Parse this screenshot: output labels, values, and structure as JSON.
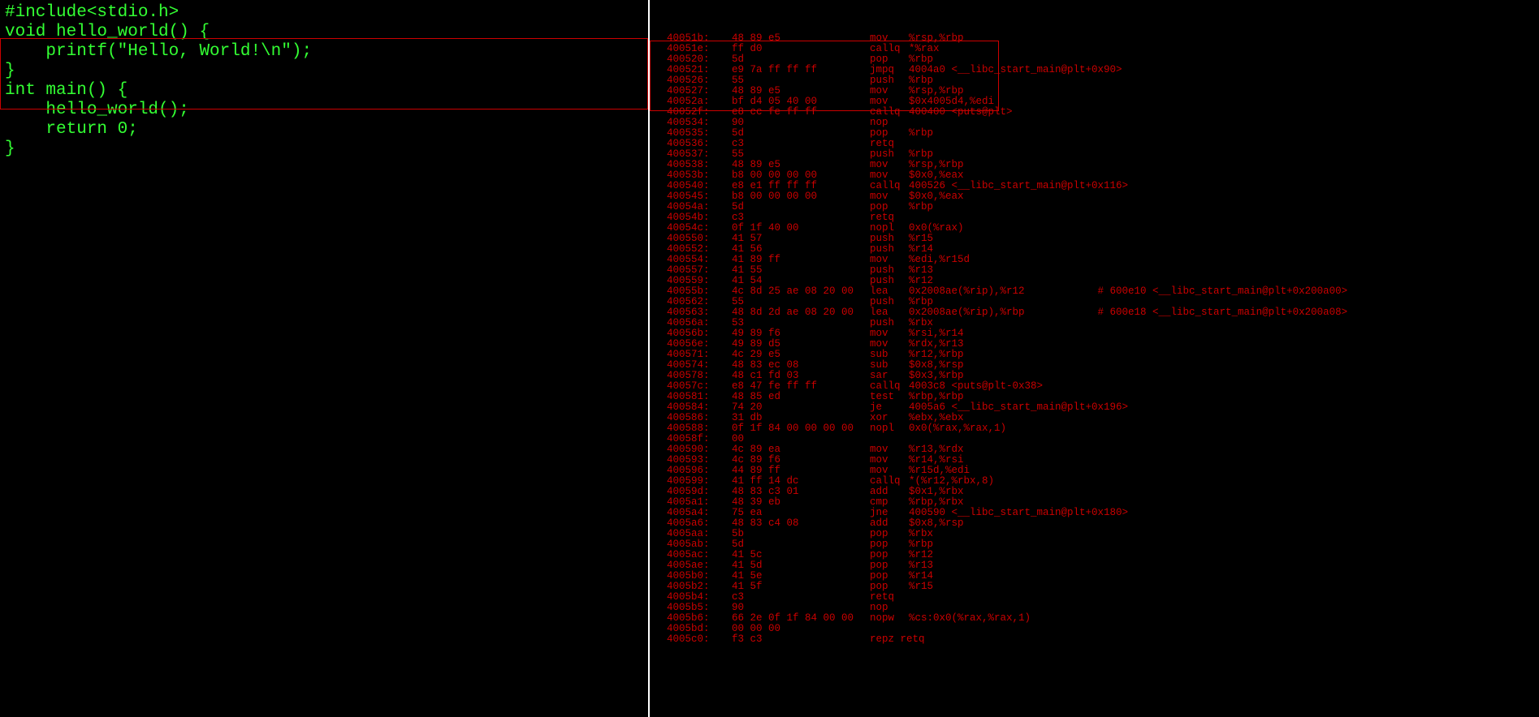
{
  "source": {
    "lines": [
      "#include<stdio.h>",
      "",
      "void hello_world() {",
      "    printf(\"Hello, World!\\n\");",
      "}",
      "",
      "",
      "int main() {",
      "    hello_world();",
      "    return 0;",
      "}"
    ]
  },
  "asm": {
    "rows": [
      {
        "addr": "40051b:",
        "bytes": "48 89 e5",
        "mnem": "mov",
        "ops": "%rsp,%rbp"
      },
      {
        "addr": "40051e:",
        "bytes": "ff d0",
        "mnem": "callq",
        "ops": "*%rax"
      },
      {
        "addr": "400520:",
        "bytes": "5d",
        "mnem": "pop",
        "ops": "%rbp"
      },
      {
        "addr": "400521:",
        "bytes": "e9 7a ff ff ff",
        "mnem": "jmpq",
        "ops": "4004a0 <__libc_start_main@plt+0x90>"
      },
      {
        "addr": "400526:",
        "bytes": "55",
        "mnem": "push",
        "ops": "%rbp"
      },
      {
        "addr": "400527:",
        "bytes": "48 89 e5",
        "mnem": "mov",
        "ops": "%rsp,%rbp"
      },
      {
        "addr": "40052a:",
        "bytes": "bf d4 05 40 00",
        "mnem": "mov",
        "ops": "$0x4005d4,%edi"
      },
      {
        "addr": "40052f:",
        "bytes": "e8 cc fe ff ff",
        "mnem": "callq",
        "ops": "400400 <puts@plt>"
      },
      {
        "addr": "400534:",
        "bytes": "90",
        "mnem": "nop",
        "ops": ""
      },
      {
        "addr": "400535:",
        "bytes": "5d",
        "mnem": "pop",
        "ops": "%rbp"
      },
      {
        "addr": "400536:",
        "bytes": "c3",
        "mnem": "retq",
        "ops": ""
      },
      {
        "addr": "400537:",
        "bytes": "55",
        "mnem": "push",
        "ops": "%rbp"
      },
      {
        "addr": "400538:",
        "bytes": "48 89 e5",
        "mnem": "mov",
        "ops": "%rsp,%rbp"
      },
      {
        "addr": "40053b:",
        "bytes": "b8 00 00 00 00",
        "mnem": "mov",
        "ops": "$0x0,%eax"
      },
      {
        "addr": "400540:",
        "bytes": "e8 e1 ff ff ff",
        "mnem": "callq",
        "ops": "400526 <__libc_start_main@plt+0x116>"
      },
      {
        "addr": "400545:",
        "bytes": "b8 00 00 00 00",
        "mnem": "mov",
        "ops": "$0x0,%eax"
      },
      {
        "addr": "40054a:",
        "bytes": "5d",
        "mnem": "pop",
        "ops": "%rbp"
      },
      {
        "addr": "40054b:",
        "bytes": "c3",
        "mnem": "retq",
        "ops": ""
      },
      {
        "addr": "40054c:",
        "bytes": "0f 1f 40 00",
        "mnem": "nopl",
        "ops": "0x0(%rax)"
      },
      {
        "addr": "400550:",
        "bytes": "41 57",
        "mnem": "push",
        "ops": "%r15"
      },
      {
        "addr": "400552:",
        "bytes": "41 56",
        "mnem": "push",
        "ops": "%r14"
      },
      {
        "addr": "400554:",
        "bytes": "41 89 ff",
        "mnem": "mov",
        "ops": "%edi,%r15d"
      },
      {
        "addr": "400557:",
        "bytes": "41 55",
        "mnem": "push",
        "ops": "%r13"
      },
      {
        "addr": "400559:",
        "bytes": "41 54",
        "mnem": "push",
        "ops": "%r12"
      },
      {
        "addr": "40055b:",
        "bytes": "4c 8d 25 ae 08 20 00",
        "mnem": "lea",
        "ops": "0x2008ae(%rip),%r12",
        "comment": "# 600e10 <__libc_start_main@plt+0x200a00>"
      },
      {
        "addr": "400562:",
        "bytes": "55",
        "mnem": "push",
        "ops": "%rbp"
      },
      {
        "addr": "400563:",
        "bytes": "48 8d 2d ae 08 20 00",
        "mnem": "lea",
        "ops": "0x2008ae(%rip),%rbp",
        "comment": "# 600e18 <__libc_start_main@plt+0x200a08>"
      },
      {
        "addr": "40056a:",
        "bytes": "53",
        "mnem": "push",
        "ops": "%rbx"
      },
      {
        "addr": "40056b:",
        "bytes": "49 89 f6",
        "mnem": "mov",
        "ops": "%rsi,%r14"
      },
      {
        "addr": "40056e:",
        "bytes": "49 89 d5",
        "mnem": "mov",
        "ops": "%rdx,%r13"
      },
      {
        "addr": "400571:",
        "bytes": "4c 29 e5",
        "mnem": "sub",
        "ops": "%r12,%rbp"
      },
      {
        "addr": "400574:",
        "bytes": "48 83 ec 08",
        "mnem": "sub",
        "ops": "$0x8,%rsp"
      },
      {
        "addr": "400578:",
        "bytes": "48 c1 fd 03",
        "mnem": "sar",
        "ops": "$0x3,%rbp"
      },
      {
        "addr": "40057c:",
        "bytes": "e8 47 fe ff ff",
        "mnem": "callq",
        "ops": "4003c8 <puts@plt-0x38>"
      },
      {
        "addr": "400581:",
        "bytes": "48 85 ed",
        "mnem": "test",
        "ops": "%rbp,%rbp"
      },
      {
        "addr": "400584:",
        "bytes": "74 20",
        "mnem": "je",
        "ops": "4005a6 <__libc_start_main@plt+0x196>"
      },
      {
        "addr": "400586:",
        "bytes": "31 db",
        "mnem": "xor",
        "ops": "%ebx,%ebx"
      },
      {
        "addr": "400588:",
        "bytes": "0f 1f 84 00 00 00 00",
        "mnem": "nopl",
        "ops": "0x0(%rax,%rax,1)"
      },
      {
        "addr": "40058f:",
        "bytes": "00",
        "mnem": "",
        "ops": ""
      },
      {
        "addr": "400590:",
        "bytes": "4c 89 ea",
        "mnem": "mov",
        "ops": "%r13,%rdx"
      },
      {
        "addr": "400593:",
        "bytes": "4c 89 f6",
        "mnem": "mov",
        "ops": "%r14,%rsi"
      },
      {
        "addr": "400596:",
        "bytes": "44 89 ff",
        "mnem": "mov",
        "ops": "%r15d,%edi"
      },
      {
        "addr": "400599:",
        "bytes": "41 ff 14 dc",
        "mnem": "callq",
        "ops": "*(%r12,%rbx,8)"
      },
      {
        "addr": "40059d:",
        "bytes": "48 83 c3 01",
        "mnem": "add",
        "ops": "$0x1,%rbx"
      },
      {
        "addr": "4005a1:",
        "bytes": "48 39 eb",
        "mnem": "cmp",
        "ops": "%rbp,%rbx"
      },
      {
        "addr": "4005a4:",
        "bytes": "75 ea",
        "mnem": "jne",
        "ops": "400590 <__libc_start_main@plt+0x180>"
      },
      {
        "addr": "4005a6:",
        "bytes": "48 83 c4 08",
        "mnem": "add",
        "ops": "$0x8,%rsp"
      },
      {
        "addr": "4005aa:",
        "bytes": "5b",
        "mnem": "pop",
        "ops": "%rbx"
      },
      {
        "addr": "4005ab:",
        "bytes": "5d",
        "mnem": "pop",
        "ops": "%rbp"
      },
      {
        "addr": "4005ac:",
        "bytes": "41 5c",
        "mnem": "pop",
        "ops": "%r12"
      },
      {
        "addr": "4005ae:",
        "bytes": "41 5d",
        "mnem": "pop",
        "ops": "%r13"
      },
      {
        "addr": "4005b0:",
        "bytes": "41 5e",
        "mnem": "pop",
        "ops": "%r14"
      },
      {
        "addr": "4005b2:",
        "bytes": "41 5f",
        "mnem": "pop",
        "ops": "%r15"
      },
      {
        "addr": "4005b4:",
        "bytes": "c3",
        "mnem": "retq",
        "ops": ""
      },
      {
        "addr": "4005b5:",
        "bytes": "90",
        "mnem": "nop",
        "ops": ""
      },
      {
        "addr": "4005b6:",
        "bytes": "66 2e 0f 1f 84 00 00",
        "mnem": "nopw",
        "ops": "%cs:0x0(%rax,%rax,1)"
      },
      {
        "addr": "4005bd:",
        "bytes": "00 00 00",
        "mnem": "",
        "ops": ""
      },
      {
        "addr": "4005c0:",
        "bytes": "f3 c3",
        "mnem": "repz retq",
        "ops": ""
      }
    ]
  }
}
